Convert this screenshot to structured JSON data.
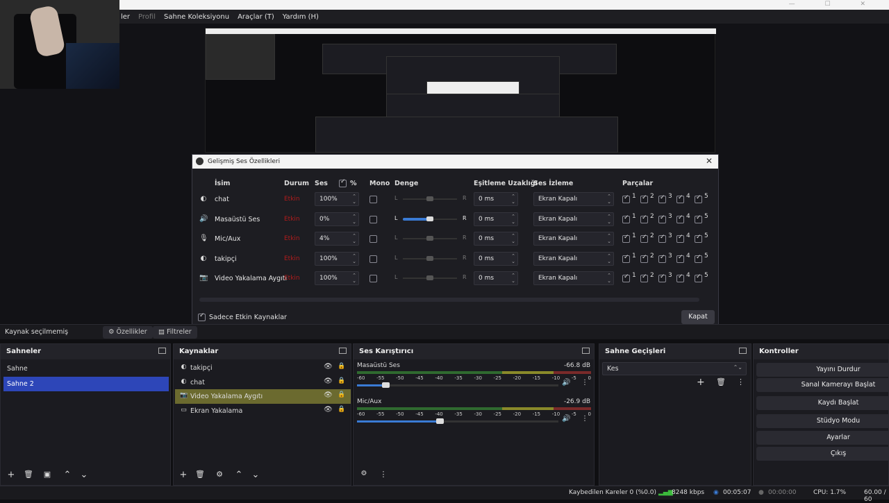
{
  "menu": {
    "items": [
      "ler",
      "Profil",
      "Sahne Koleksiyonu",
      "Araçlar (T)",
      "Yardım (H)"
    ]
  },
  "dialog": {
    "title": "Gelişmiş Ses Özellikleri",
    "headers": {
      "name": "İsim",
      "status": "Durum",
      "volume": "Ses",
      "percent": "%",
      "mono": "Mono",
      "balance": "Denge",
      "sync_offset": "Eşitleme Uzaklığı",
      "monitoring": "Ses İzleme",
      "tracks": "Parçalar"
    },
    "rows": [
      {
        "icon": "browser-icon",
        "name": "chat",
        "status": "Etkin",
        "volume": "100%",
        "balance_left": "L",
        "balance_right": "R",
        "sync": "0 ms",
        "monitoring": "Ekran Kapalı",
        "tracks": [
          "1",
          "2",
          "3",
          "4",
          "5"
        ]
      },
      {
        "icon": "speaker-icon",
        "name": "Masaüstü Ses",
        "status": "Etkin",
        "volume": "0%",
        "balance_left": "L",
        "balance_right": "R",
        "sync": "0 ms",
        "monitoring": "Ekran Kapalı",
        "tracks": [
          "1",
          "2",
          "3",
          "4",
          "5"
        ]
      },
      {
        "icon": "microphone-icon",
        "name": "Mic/Aux",
        "status": "Etkin",
        "volume": "4%",
        "balance_left": "L",
        "balance_right": "R",
        "sync": "0 ms",
        "monitoring": "Ekran Kapalı",
        "tracks": [
          "1",
          "2",
          "3",
          "4",
          "5"
        ]
      },
      {
        "icon": "browser-icon",
        "name": "takipçi",
        "status": "Etkin",
        "volume": "100%",
        "balance_left": "L",
        "balance_right": "R",
        "sync": "0 ms",
        "monitoring": "Ekran Kapalı",
        "tracks": [
          "1",
          "2",
          "3",
          "4",
          "5"
        ]
      },
      {
        "icon": "camera-icon",
        "name": "Video Yakalama Aygıtı",
        "status": "Etkin",
        "volume": "100%",
        "balance_left": "L",
        "balance_right": "R",
        "sync": "0 ms",
        "monitoring": "Ekran Kapalı",
        "tracks": [
          "1",
          "2",
          "3",
          "4",
          "5"
        ]
      }
    ],
    "only_active_label": "Sadece Etkin Kaynaklar",
    "close_label": "Kapat"
  },
  "source_toolbar": {
    "no_source": "Kaynak seçilmemiş",
    "properties": "Özellikler",
    "filters": "Filtreler"
  },
  "scenes": {
    "title": "Sahneler",
    "items": [
      "Sahne",
      "Sahne 2"
    ],
    "selected": 1
  },
  "sources": {
    "title": "Kaynaklar",
    "items": [
      {
        "icon": "browser-icon",
        "name": "takipçi"
      },
      {
        "icon": "browser-icon",
        "name": "chat"
      },
      {
        "icon": "camera-icon",
        "name": "Video Yakalama Aygıtı"
      },
      {
        "icon": "monitor-icon",
        "name": "Ekran Yakalama"
      }
    ],
    "selected": 2
  },
  "mixer": {
    "title": "Ses Karıştırıcı",
    "channels": [
      {
        "name": "Masaüstü Ses",
        "db": "-66.8 dB",
        "volume_fraction": 0.14
      },
      {
        "name": "Mic/Aux",
        "db": "-26.9 dB",
        "volume_fraction": 0.41
      }
    ],
    "scale": [
      "-60",
      "-55",
      "-50",
      "-45",
      "-40",
      "-35",
      "-30",
      "-25",
      "-20",
      "-15",
      "-10",
      "-5",
      "0"
    ]
  },
  "transitions": {
    "title": "Sahne Geçişleri",
    "current": "Kes"
  },
  "controls": {
    "title": "Kontroller",
    "buttons": [
      "Yayını Durdur",
      "Sanal Kamerayı Başlat",
      "Kaydı Başlat",
      "Stüdyo Modu",
      "Ayarlar",
      "Çıkış"
    ]
  },
  "status": {
    "dropped": "Kaybedilen Kareler 0 (%0.0)",
    "bitrate": "8248 kbps",
    "live_time": "00:05:07",
    "rec_time": "00:00:00",
    "cpu": "CPU: 1.7%",
    "fps": "60.00 / 60"
  }
}
